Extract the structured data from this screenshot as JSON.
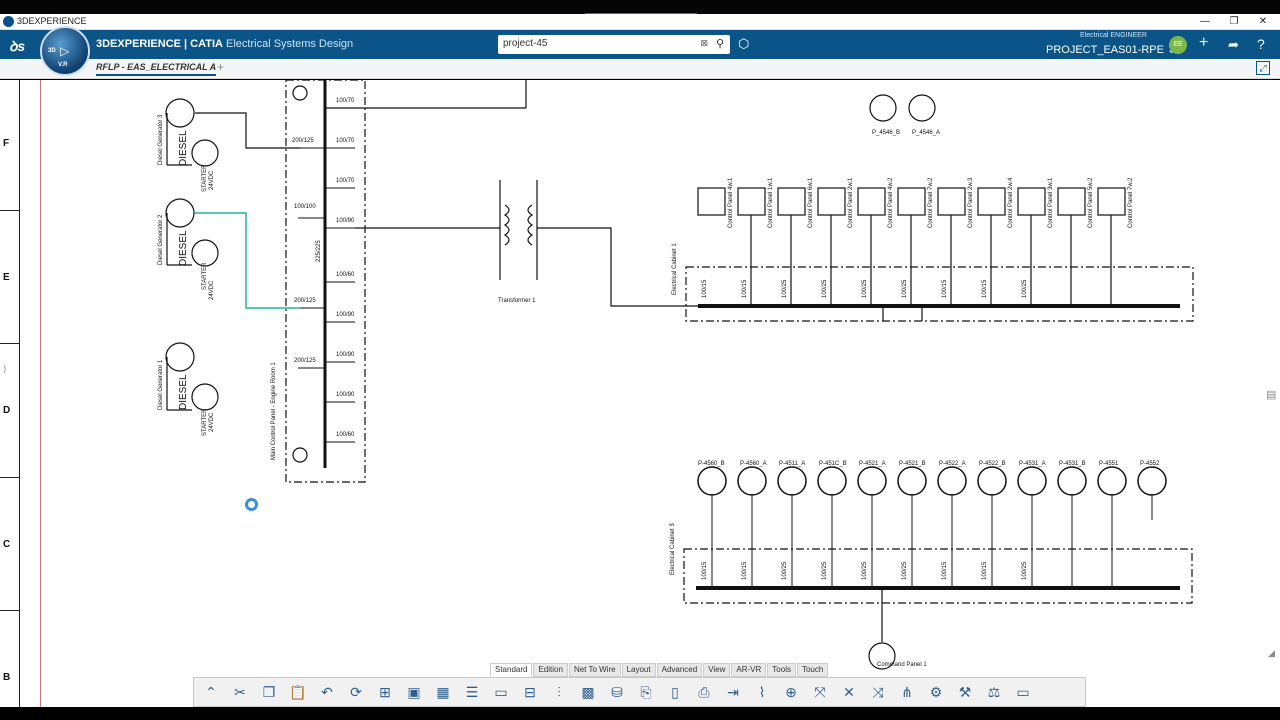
{
  "window": {
    "title": "3DEXPERIENCE",
    "controls": [
      "—",
      "❐",
      "✕"
    ]
  },
  "header": {
    "brand_prefix": "3DEXPERIENCE | CATIA",
    "brand_app": "Electrical Systems Design",
    "compass_version": "V.R",
    "compass_3d": "3D",
    "search_value": "project-45",
    "role": "Electrical  ENGINEER",
    "project": "PROJECT_EAS01-RPE",
    "avatar": "EE"
  },
  "tabs": {
    "active": "RFLP - EAS_ELECTRICAL A",
    "add": "+"
  },
  "ruler": [
    "F",
    "E",
    "D",
    "C",
    "B"
  ],
  "toolbar_tabs": [
    "Standard",
    "Edition",
    "Net To Wire",
    "Layout",
    "Advanced",
    "View",
    "AR-VR",
    "Tools",
    "Touch"
  ],
  "toolbar_icons": [
    "cut-icon",
    "copy-icon",
    "paste-icon",
    "undo-icon",
    "refresh-icon",
    "insert-icon",
    "image-icon",
    "table-icon",
    "properties-icon",
    "display-icon",
    "network-icon",
    "align-icon",
    "grid-icon",
    "database-icon",
    "catalog-icon",
    "document-icon",
    "report-icon",
    "export-icon",
    "route-icon",
    "connect-icon",
    "link-icon",
    "break-icon",
    "split-icon",
    "tree-icon",
    "harness-icon",
    "tools-icon",
    "settings-icon",
    "view-icon"
  ],
  "schematic": {
    "generators": [
      "Diesel Generator 3",
      "Diesel Generator 2",
      "Diesel Generator 1"
    ],
    "diesel_label": "DIESEL",
    "starter_label": "STARTER",
    "starter_voltage": "24VDC",
    "main_panel": "Main Control Panel - Engine Room 1",
    "transformer": "Transformer 1",
    "cabinet1": "Electrical Cabinet 1",
    "cabinet3": "Electrical Cabinet 3",
    "command_panel": "Command Panel 1",
    "top_pumps": [
      "P_4546_B",
      "P_4546_A"
    ],
    "bottom_pumps": [
      "P-4560_B",
      "P-4560_A",
      "P-4511_A",
      "P-451C_B",
      "P-4521_A",
      "P-4521_B",
      "P-4522_A",
      "P-4522_B",
      "P-4531_A",
      "P-4531_B",
      "P-4551",
      "P-4552"
    ],
    "control_panels": [
      "Control Panel 4w.1",
      "Control Panel 1w.1",
      "Control Panel 6w.1",
      "Control Panel 2w.1",
      "Control Panel 4w.2",
      "Control Panel 7w.2",
      "Control Panel 2w.3",
      "Control Panel 2w.4",
      "Control Panel 3w.1",
      "Control Panel 5w.2",
      "Control Panel 7w.2"
    ],
    "breaker_ratings": [
      "100/70",
      "100/70",
      "100/70",
      "100/100",
      "100/90",
      "100/60",
      "100/90",
      "100/90",
      "100/90",
      "100/60"
    ],
    "main_ratings": [
      "200/125",
      "200/125",
      "200/125",
      "225/225"
    ],
    "cabinet_ratings": [
      "100/15",
      "100/15",
      "100/25",
      "100/25",
      "100/25",
      "100/25",
      "100/15",
      "100/15",
      "100/25",
      "100/15"
    ]
  }
}
